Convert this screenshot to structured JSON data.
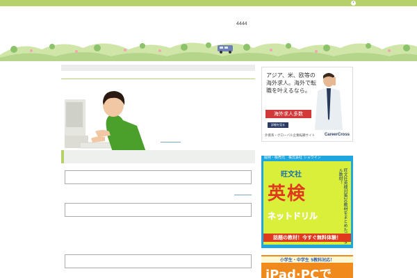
{
  "header": {
    "site_title": "4444",
    "top_button_icon": "chevron-right-icon",
    "accent": "#b6d16a"
  },
  "ads": {
    "careercross": {
      "headline": "アジア、米、欧等の海外求人。海外で転職を叶えるなら。",
      "badge": "海外求人多数",
      "button": "詳細を見る",
      "footer": "外資系・グローバル企業転職サイト",
      "logo": "CareerCross"
    },
    "eiken": {
      "header": "開発・販売元　株式会社 ショウイン",
      "publisher": "旺文社",
      "vertical_text": "旺文社英検対策20教材をまとめたデジタル教材！",
      "title": "英検",
      "subtitle": "ネットドリル",
      "cta": "話題の教材！今すぐ無料体験！"
    },
    "ipad": {
      "top": "小学生・中学生 5教科対応！",
      "title": "iPad·PCで"
    }
  }
}
